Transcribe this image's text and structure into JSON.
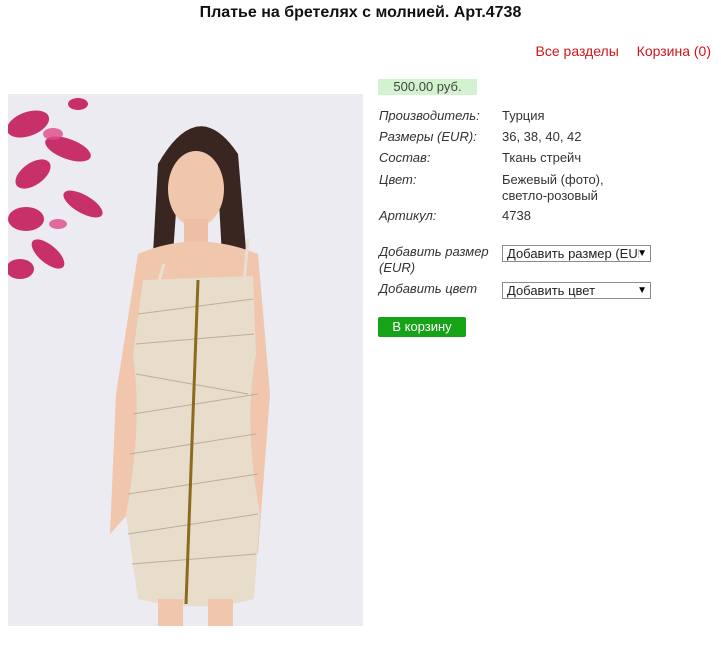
{
  "header": {
    "title": "Платье на бретелях с молнией. Арт.4738"
  },
  "nav": {
    "all_sections": "Все разделы",
    "cart": "Корзина (0)"
  },
  "product": {
    "price": "500.00 руб.",
    "properties": [
      {
        "label": "Производитель:",
        "value": "Турция"
      },
      {
        "label": "Размеры (EUR):",
        "value": "36, 38, 40, 42"
      },
      {
        "label": "Состав:",
        "value": "Ткань стрейч"
      },
      {
        "label": "Цвет:",
        "value": "Бежевый (фото), светло-розовый"
      },
      {
        "label": "Артикул:",
        "value": "4738"
      }
    ],
    "add_size_label": "Добавить размер (EUR)",
    "add_size_select": "Добавить размер (EUR)",
    "add_color_label": "Добавить цвет",
    "add_color_select": "Добавить цвет",
    "add_to_cart": "В корзину"
  },
  "colors": {
    "link": "#d0141a",
    "price_bg": "#d3f2cf",
    "button": "#17a317"
  }
}
